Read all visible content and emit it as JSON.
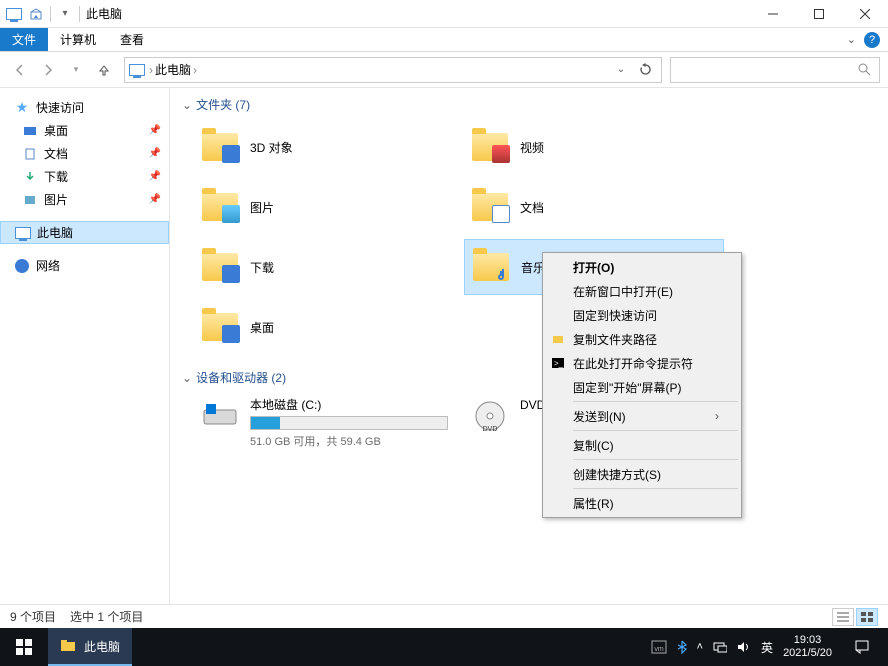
{
  "titlebar": {
    "title": "此电脑"
  },
  "ribbon": {
    "file": "文件",
    "computer": "计算机",
    "view": "查看"
  },
  "address": {
    "crumb": "此电脑"
  },
  "sidebar": {
    "quick": "快速访问",
    "items": [
      {
        "label": "桌面"
      },
      {
        "label": "文档"
      },
      {
        "label": "下载"
      },
      {
        "label": "图片"
      }
    ],
    "thispc": "此电脑",
    "network": "网络"
  },
  "content": {
    "folders_header": "文件夹 (7)",
    "folders": [
      {
        "label": "3D 对象"
      },
      {
        "label": "视频"
      },
      {
        "label": "图片"
      },
      {
        "label": "文档"
      },
      {
        "label": "下载"
      },
      {
        "label": "音乐"
      },
      {
        "label": "桌面"
      }
    ],
    "drives_header": "设备和驱动器 (2)",
    "drives": [
      {
        "label": "本地磁盘 (C:)",
        "sub": "51.0 GB 可用，共 59.4 GB",
        "fill_pct": 15
      },
      {
        "label": "DVD 驱",
        "sub": ""
      }
    ]
  },
  "ctx": {
    "open": "打开(O)",
    "newwindow": "在新窗口中打开(E)",
    "pinquick": "固定到快速访问",
    "copypath": "复制文件夹路径",
    "opencmd": "在此处打开命令提示符",
    "pinstart": "固定到\"开始\"屏幕(P)",
    "sendto": "发送到(N)",
    "copy": "复制(C)",
    "shortcut": "创建快捷方式(S)",
    "props": "属性(R)"
  },
  "status": {
    "items": "9 个项目",
    "selected": "选中 1 个项目"
  },
  "taskbar": {
    "active": "此电脑",
    "ime": "英",
    "time": "19:03",
    "date": "2021/5/20"
  }
}
